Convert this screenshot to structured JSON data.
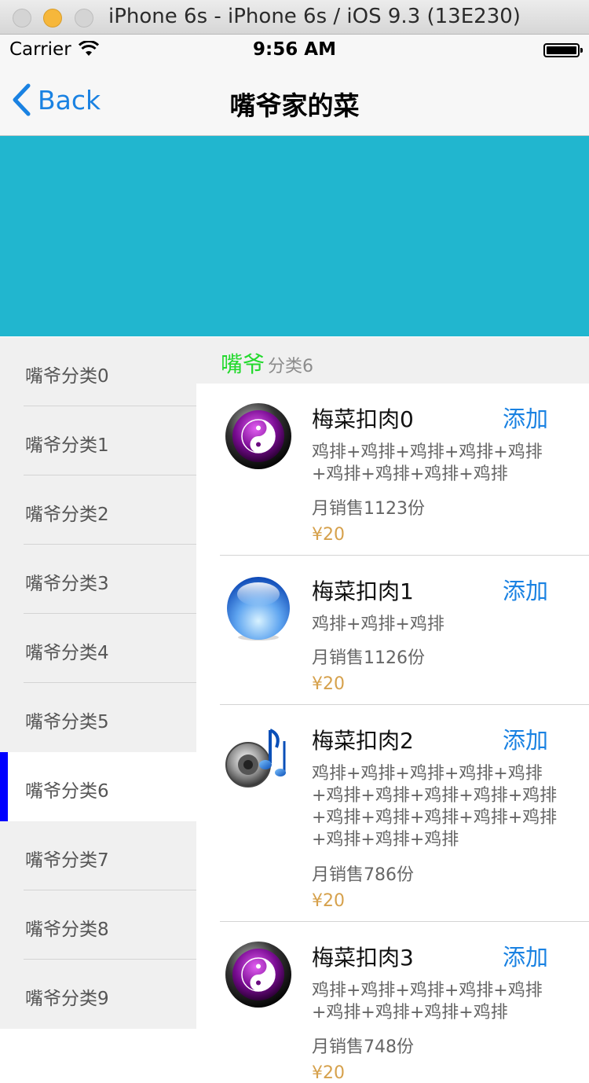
{
  "simulator": {
    "title": "iPhone 6s - iPhone 6s / iOS 9.3 (13E230)"
  },
  "status_bar": {
    "carrier": "Carrier",
    "time": "9:56 AM"
  },
  "nav": {
    "back_label": "Back",
    "title": "嘴爷家的菜"
  },
  "sidebar": {
    "items": [
      {
        "label": "嘴爷分类0"
      },
      {
        "label": "嘴爷分类1"
      },
      {
        "label": "嘴爷分类2"
      },
      {
        "label": "嘴爷分类3"
      },
      {
        "label": "嘴爷分类4"
      },
      {
        "label": "嘴爷分类5"
      },
      {
        "label": "嘴爷分类6"
      },
      {
        "label": "嘴爷分类7"
      },
      {
        "label": "嘴爷分类8"
      },
      {
        "label": "嘴爷分类9"
      }
    ],
    "selected_label": "嘴爷分类6"
  },
  "section": {
    "brand": "嘴爷",
    "subtitle": "分类6"
  },
  "items": [
    {
      "name": "梅菜扣肉0",
      "add_label": "添加",
      "desc": "鸡排+鸡排+鸡排+鸡排+鸡排+鸡排+鸡排+鸡排+鸡排",
      "sales": "月销售1123份",
      "price": "¥20",
      "icon": "yin-yang-icon"
    },
    {
      "name": "梅菜扣肉1",
      "add_label": "添加",
      "desc": "鸡排+鸡排+鸡排",
      "sales": "月销售1126份",
      "price": "¥20",
      "icon": "blue-orb-icon"
    },
    {
      "name": "梅菜扣肉2",
      "add_label": "添加",
      "desc": "鸡排+鸡排+鸡排+鸡排+鸡排+鸡排+鸡排+鸡排+鸡排+鸡排+鸡排+鸡排+鸡排+鸡排+鸡排+鸡排+鸡排+鸡排",
      "sales": "月销售786份",
      "price": "¥20",
      "icon": "speaker-music-icon"
    },
    {
      "name": "梅菜扣肉3",
      "add_label": "添加",
      "desc": "鸡排+鸡排+鸡排+鸡排+鸡排+鸡排+鸡排+鸡排+鸡排",
      "sales": "月销售748份",
      "price": "¥20",
      "icon": "yin-yang-icon"
    }
  ],
  "colors": {
    "accent": "#1a82e2",
    "banner": "#21b6cf",
    "brand": "#23d92d",
    "price": "#d6a14c",
    "selected_marker": "#0000ff"
  }
}
